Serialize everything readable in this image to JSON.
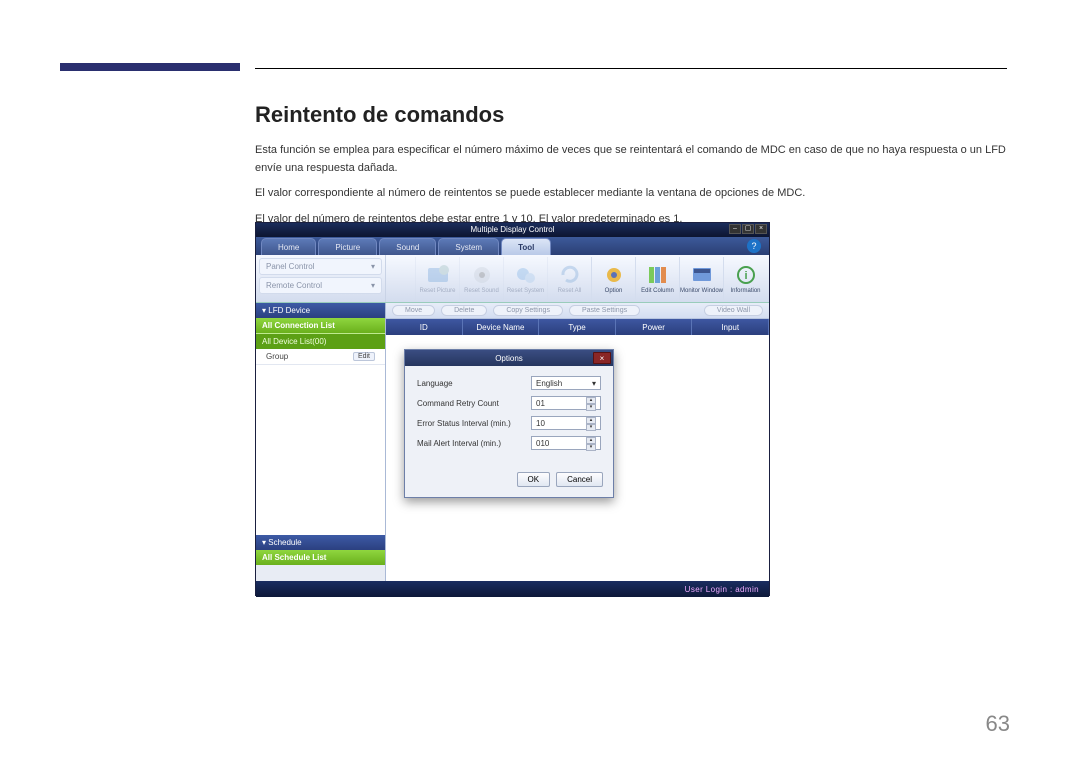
{
  "page": {
    "heading": "Reintento de comandos",
    "para1": "Esta función se emplea para especificar el número máximo de veces que se reintentará el comando de MDC en caso de que no haya respuesta o un LFD envíe una respuesta dañada.",
    "para2": "El valor correspondiente al número de reintentos se puede establecer mediante la ventana de opciones de MDC.",
    "para3": "El valor del número de reintentos debe estar entre 1 y 10. El valor predeterminado es 1.",
    "number": "63"
  },
  "app": {
    "title": "Multiple Display Control",
    "tabs": [
      "Home",
      "Picture",
      "Sound",
      "System",
      "Tool"
    ],
    "activeTab": "Tool",
    "help": "?",
    "side": {
      "panelControl": "Panel Control",
      "remoteControl": "Remote Control"
    },
    "tools": {
      "resetPicture": "Reset Picture",
      "resetSound": "Reset Sound",
      "resetSystem": "Reset System",
      "resetAll": "Reset All",
      "option": "Option",
      "editColumn": "Edit Column",
      "monitorWindow": "Monitor Window",
      "information": "Information"
    },
    "pills": {
      "move": "Move",
      "delete": "Delete",
      "copySettings": "Copy Settings",
      "pasteSettings": "Paste Settings",
      "videoWall": "Video Wall"
    },
    "cols": [
      "ID",
      "Device Name",
      "Type",
      "Power",
      "Input"
    ],
    "nav": {
      "lfdDevice": "LFD Device",
      "allConn": "All Connection List",
      "allDevice": "All Device List(00)",
      "group": "Group",
      "edit": "Edit",
      "schedule": "Schedule",
      "allSchedule": "All Schedule List"
    },
    "dialog": {
      "title": "Options",
      "language": {
        "label": "Language",
        "value": "English"
      },
      "retry": {
        "label": "Command Retry Count",
        "value": "01"
      },
      "errorStatus": {
        "label": "Error Status Interval (min.)",
        "value": "10"
      },
      "mailAlert": {
        "label": "Mail Alert Interval (min.)",
        "value": "010"
      },
      "ok": "OK",
      "cancel": "Cancel"
    },
    "status": "User Login : admin"
  }
}
